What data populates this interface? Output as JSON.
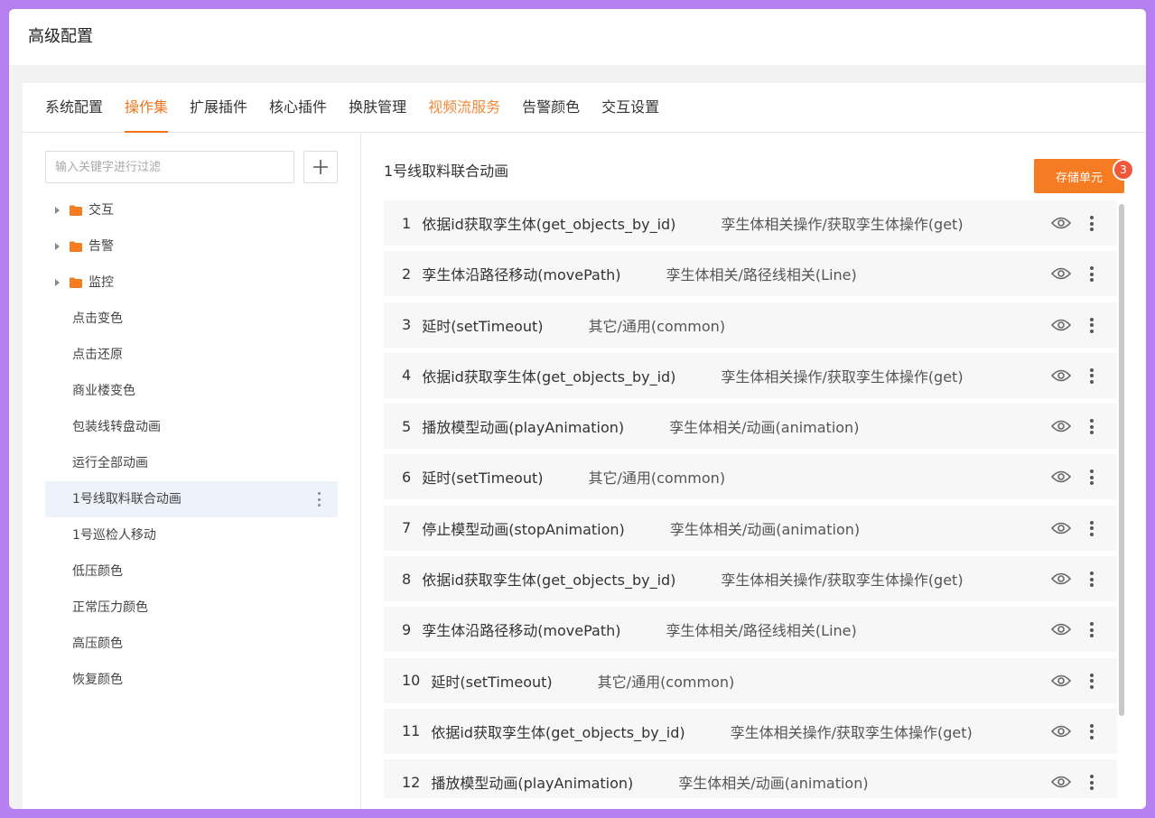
{
  "window": {
    "title": "高级配置"
  },
  "tabs": [
    {
      "label": "系统配置"
    },
    {
      "label": "操作集"
    },
    {
      "label": "扩展插件"
    },
    {
      "label": "核心插件"
    },
    {
      "label": "换肤管理"
    },
    {
      "label": "视频流服务"
    },
    {
      "label": "告警颜色"
    },
    {
      "label": "交互设置"
    }
  ],
  "sidebar": {
    "filter_placeholder": "输入关键字进行过滤",
    "add_icon": "plus-icon",
    "folders": [
      {
        "label": "交互"
      },
      {
        "label": "告警"
      },
      {
        "label": "监控"
      }
    ],
    "items": [
      {
        "label": "点击变色"
      },
      {
        "label": "点击还原"
      },
      {
        "label": "商业楼变色"
      },
      {
        "label": "包装线转盘动画"
      },
      {
        "label": "运行全部动画"
      },
      {
        "label": "1号线取料联合动画"
      },
      {
        "label": "1号巡检人移动"
      },
      {
        "label": "低压颜色"
      },
      {
        "label": "正常压力颜色"
      },
      {
        "label": "高压颜色"
      },
      {
        "label": "恢复颜色"
      }
    ]
  },
  "content": {
    "title": "1号线取料联合动画",
    "store_button": "存储单元",
    "store_badge": "3",
    "rows": [
      {
        "index": "1",
        "name": "依据id获取孪生体(get_objects_by_id)",
        "category": "孪生体相关操作/获取孪生体操作(get)"
      },
      {
        "index": "2",
        "name": "孪生体沿路径移动(movePath)",
        "category": "孪生体相关/路径线相关(Line)"
      },
      {
        "index": "3",
        "name": "延时(setTimeout)",
        "category": "其它/通用(common)"
      },
      {
        "index": "4",
        "name": "依据id获取孪生体(get_objects_by_id)",
        "category": "孪生体相关操作/获取孪生体操作(get)"
      },
      {
        "index": "5",
        "name": "播放模型动画(playAnimation)",
        "category": "孪生体相关/动画(animation)"
      },
      {
        "index": "6",
        "name": "延时(setTimeout)",
        "category": "其它/通用(common)"
      },
      {
        "index": "7",
        "name": "停止模型动画(stopAnimation)",
        "category": "孪生体相关/动画(animation)"
      },
      {
        "index": "8",
        "name": "依据id获取孪生体(get_objects_by_id)",
        "category": "孪生体相关操作/获取孪生体操作(get)"
      },
      {
        "index": "9",
        "name": "孪生体沿路径移动(movePath)",
        "category": "孪生体相关/路径线相关(Line)"
      },
      {
        "index": "10",
        "name": "延时(setTimeout)",
        "category": "其它/通用(common)"
      },
      {
        "index": "11",
        "name": "依据id获取孪生体(get_objects_by_id)",
        "category": "孪生体相关操作/获取孪生体操作(get)"
      },
      {
        "index": "12",
        "name": "播放模型动画(playAnimation)",
        "category": "孪生体相关/动画(animation)"
      }
    ]
  },
  "colors": {
    "accent": "#f07520",
    "frame": "#b57ff0",
    "badge": "#f0583a",
    "selected_bg": "#eef3fb"
  }
}
